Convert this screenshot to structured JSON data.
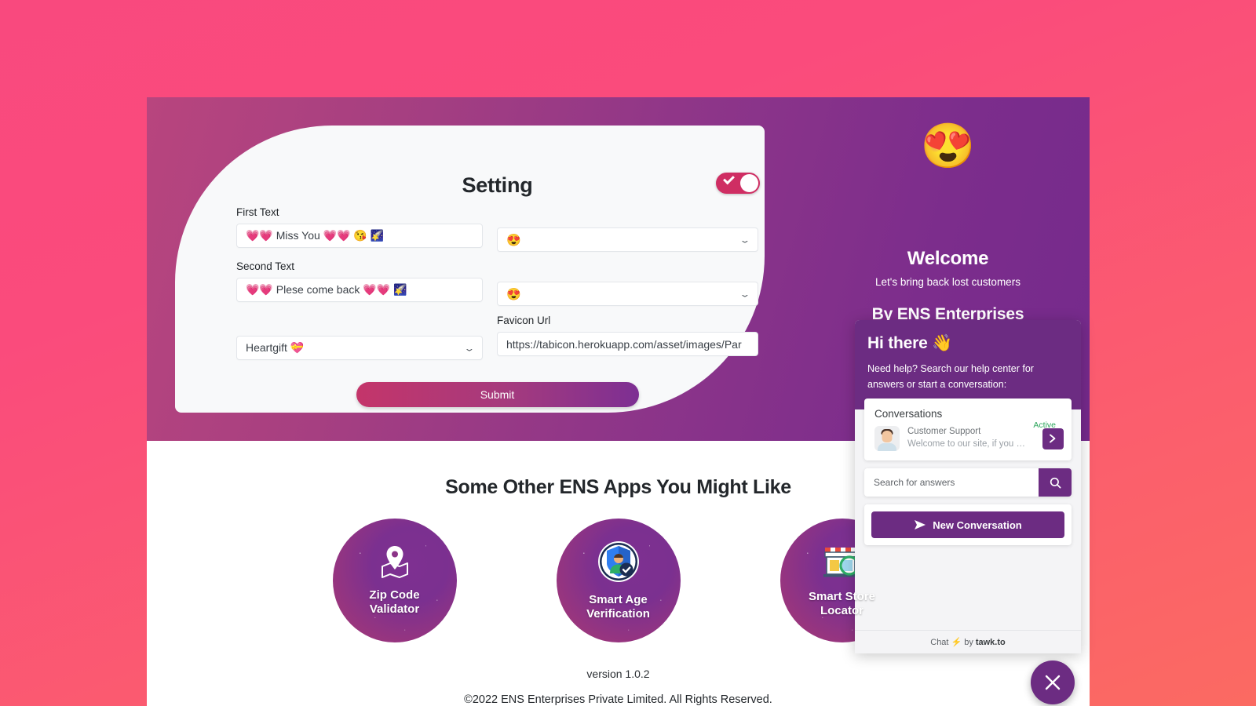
{
  "hero": {
    "setting_title": "Setting",
    "toggle_state": "on",
    "fields": {
      "first_text_label": "First Text",
      "first_text_value": "💗💗 Miss You 💗💗 😘 🌠",
      "first_emoji_value": "😍",
      "second_text_label": "Second Text",
      "second_text_value": "💗💗 Plese come back 💗💗 🌠",
      "second_emoji_value": "😍",
      "theme_value": "Heartgift 💝",
      "favicon_label": "Favicon Url",
      "favicon_value": "https://tabicon.herokuapp.com/asset/images/Par"
    },
    "submit_label": "Submit",
    "right": {
      "emoji": "😍",
      "welcome": "Welcome",
      "subtitle": "Let's bring back lost customers",
      "by_line": "By ENS Enterprises"
    }
  },
  "apps": {
    "title": "Some Other ENS Apps You Might Like",
    "items": [
      {
        "label": "Zip Code\nValidator",
        "icon": "📍"
      },
      {
        "label": "Smart Age\nVerification",
        "icon": "🛡"
      },
      {
        "label": "Smart Store\nLocator",
        "icon": "🏪"
      }
    ]
  },
  "footer": {
    "version": "version 1.0.2",
    "copyright": "©2022 ENS Enterprises Private Limited. All Rights Reserved."
  },
  "chat": {
    "greeting": "Hi there 👋",
    "description": "Need help? Search our help center for answers or start a conversation:",
    "conversations_title": "Conversations",
    "conversation": {
      "name": "Customer Support",
      "preview": "Welcome to our site, if you nee...",
      "status": "Active"
    },
    "search_placeholder": "Search for answers",
    "new_conversation_label": "New Conversation",
    "footer_prefix": "Chat",
    "footer_bolt": "⚡",
    "footer_by": "by",
    "footer_brand": "tawk.to"
  },
  "colors": {
    "accent_pink": "#cf2e63",
    "accent_purple": "#6c2c82",
    "active_green": "#2aa45a",
    "page_bg_start": "#f9497e",
    "page_bg_end": "#fb6a62"
  }
}
